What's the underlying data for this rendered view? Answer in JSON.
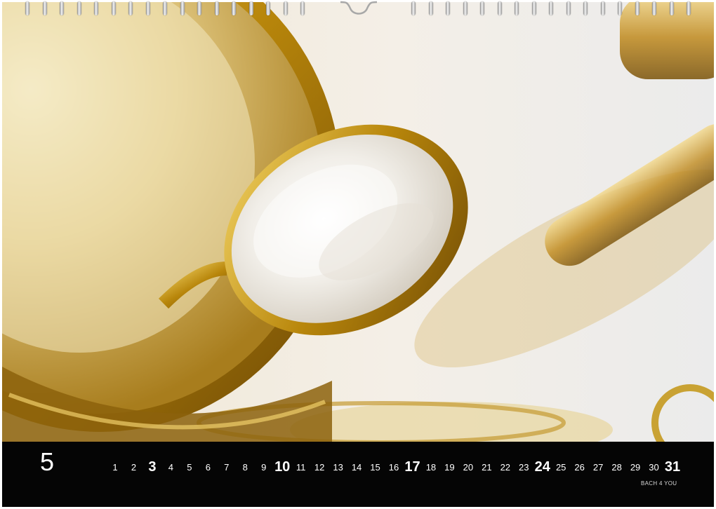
{
  "calendar": {
    "month": "5",
    "days": [
      "1",
      "2",
      "3",
      "4",
      "5",
      "6",
      "7",
      "8",
      "9",
      "10",
      "11",
      "12",
      "13",
      "14",
      "15",
      "16",
      "17",
      "18",
      "19",
      "20",
      "21",
      "22",
      "23",
      "24",
      "25",
      "26",
      "27",
      "28",
      "29",
      "30",
      "31"
    ],
    "emphasized_days": [
      "3",
      "10",
      "17",
      "24",
      "31"
    ],
    "brand": "BACH 4 YOU"
  },
  "colors": {
    "bar": "#050505",
    "gold": "#c9a233",
    "pearl": "#f1efea",
    "text": "#ffffff"
  },
  "photo": {
    "subject": "saxophone-key-icon"
  }
}
